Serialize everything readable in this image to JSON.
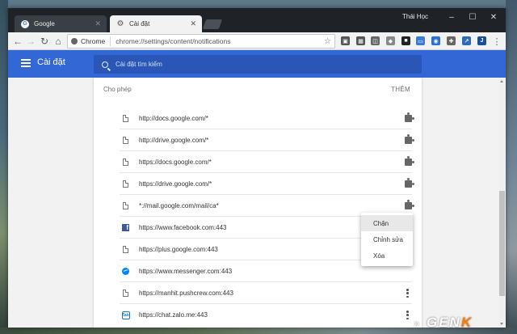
{
  "browser": {
    "tabs": [
      {
        "label": "Google",
        "icon": "google-favicon"
      },
      {
        "label": "Cài đặt",
        "icon": "gear-icon"
      }
    ],
    "user_name": "Thái Học",
    "window_controls": {
      "minimize": "–",
      "maximize": "☐",
      "close": "✕"
    },
    "omnibox": {
      "badge": "Chrome",
      "url": "chrome://settings/content/notifications"
    }
  },
  "header": {
    "title": "Cài đặt",
    "search_placeholder": "Cài đặt tìm kiếm"
  },
  "section": {
    "label": "Cho phép",
    "add_label": "THÊM"
  },
  "sites": [
    {
      "url": "http://docs.google.com/*",
      "icon": "file-icon",
      "action": "puzzle-icon"
    },
    {
      "url": "http://drive.google.com/*",
      "icon": "file-icon",
      "action": "puzzle-icon"
    },
    {
      "url": "https://docs.google.com/*",
      "icon": "file-icon",
      "action": "puzzle-icon"
    },
    {
      "url": "https://drive.google.com/*",
      "icon": "file-icon",
      "action": "puzzle-icon"
    },
    {
      "url": "*://mail.google.com/mail/ca*",
      "icon": "file-icon",
      "action": "puzzle-icon"
    },
    {
      "url": "https://www.facebook.com:443",
      "icon": "facebook-icon",
      "action": "none"
    },
    {
      "url": "https://plus.google.com:443",
      "icon": "file-icon",
      "action": "none"
    },
    {
      "url": "https://www.messenger.com:443",
      "icon": "messenger-icon",
      "action": "none"
    },
    {
      "url": "https://manhit.pushcrew.com:443",
      "icon": "file-icon",
      "action": "more-icon"
    },
    {
      "url": "https://chat.zalo.me:443",
      "icon": "zalo-icon",
      "action": "more-icon"
    }
  ],
  "context_menu": {
    "items": [
      "Chặn",
      "Chỉnh sửa",
      "Xóa"
    ]
  },
  "colors": {
    "header_blue": "#3367d6",
    "facebook_blue": "#3b5998",
    "messenger_blue": "#0084ff"
  },
  "watermark": {
    "text": "GEN",
    "accent": "K"
  }
}
